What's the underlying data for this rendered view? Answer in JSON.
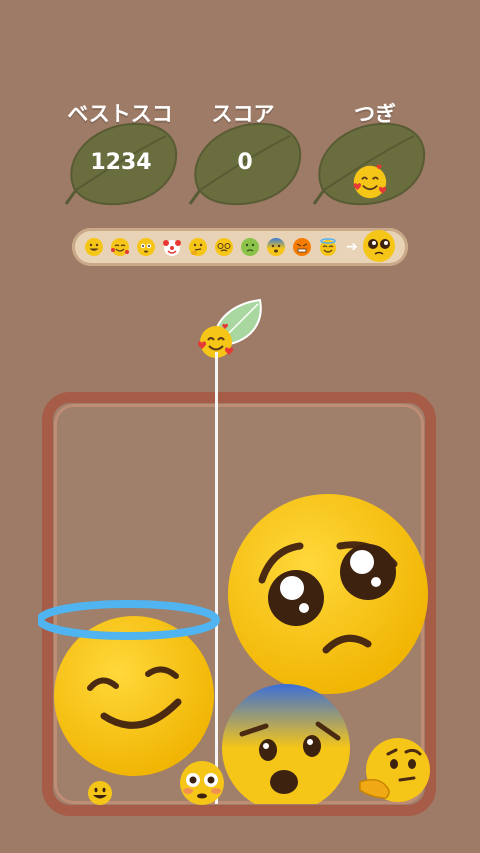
{
  "header": {
    "best_score_label": "ベストスコア",
    "best_score_value": "1234",
    "score_label": "スコア",
    "score_value": "0",
    "next_label": "つぎ",
    "next_icon": "smiling-face-with-hearts-icon"
  },
  "progression": {
    "icons": [
      "grinning-face-icon",
      "smiling-face-with-hearts-icon",
      "flushed-face-icon",
      "clown-face-icon",
      "thinking-face-icon",
      "face-with-spiral-eyes-icon",
      "nauseated-face-icon",
      "anxious-face-icon",
      "grimacing-angry-face-icon",
      "smiling-face-with-halo-icon"
    ],
    "goal_icon": "pleading-face-icon"
  },
  "dropper": {
    "current_icon": "smiling-face-with-hearts-icon"
  },
  "board": {
    "pieces": [
      "pleading-face-icon",
      "smiling-face-with-halo-icon",
      "anxious-face-icon",
      "thinking-face-icon",
      "flushed-face-icon",
      "grinning-face-icon"
    ]
  },
  "colors": {
    "background": "#9d7b66",
    "container_border": "#a65c46",
    "leaf": "#6a6e3f",
    "emoji_yellow": "#f5c518",
    "progress_bar": "#e9d3b6"
  }
}
